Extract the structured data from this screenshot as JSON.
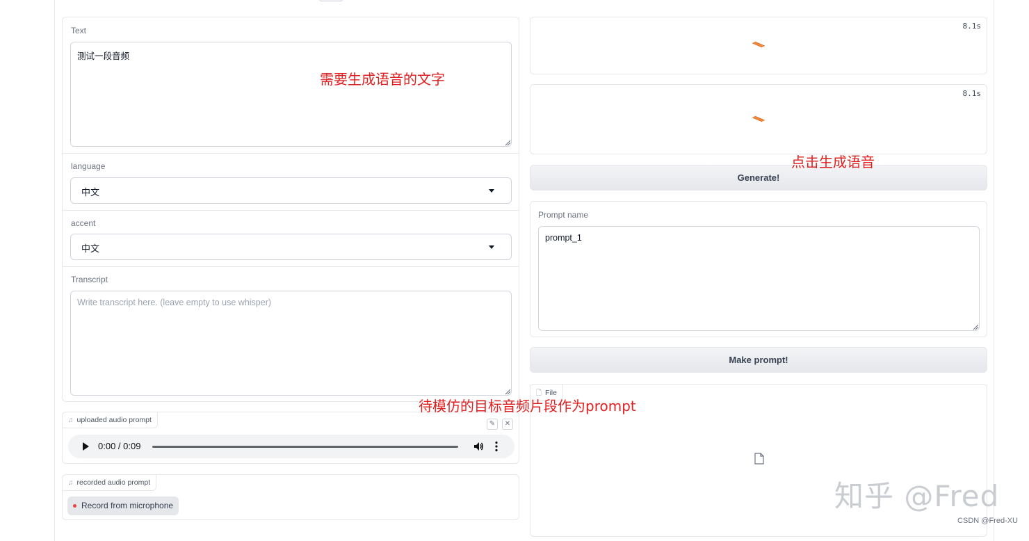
{
  "left_form": {
    "text_label": "Text",
    "text_value": "测试一段音频",
    "language_label": "language",
    "language_value": "中文",
    "accent_label": "accent",
    "accent_value": "中文",
    "transcript_label": "Transcript",
    "transcript_placeholder": "Write transcript here. (leave empty to use whisper)"
  },
  "uploaded_audio": {
    "label": "uploaded audio prompt",
    "time": "0:00 / 0:09",
    "progress": 0
  },
  "recorded_audio": {
    "label": "recorded audio prompt",
    "record_button": "Record from microphone"
  },
  "right_outputs": {
    "output1_timer": "8.1s",
    "output2_timer": "8.1s",
    "generate_button": "Generate!",
    "prompt_name_label": "Prompt name",
    "prompt_name_value": "prompt_1",
    "make_prompt_button": "Make prompt!",
    "file_label": "File"
  },
  "annotations": {
    "text_note": "需要生成语音的文字",
    "generate_note": "点击生成语音",
    "prompt_note": "待模仿的目标音频片段作为prompt"
  },
  "watermark": {
    "zhihu": "知乎 @Fred",
    "csdn": "CSDN @Fred-XU"
  },
  "colors": {
    "annotation_red": "#e02020",
    "loader_orange": "#f97316",
    "record_dot": "#ef4444"
  }
}
